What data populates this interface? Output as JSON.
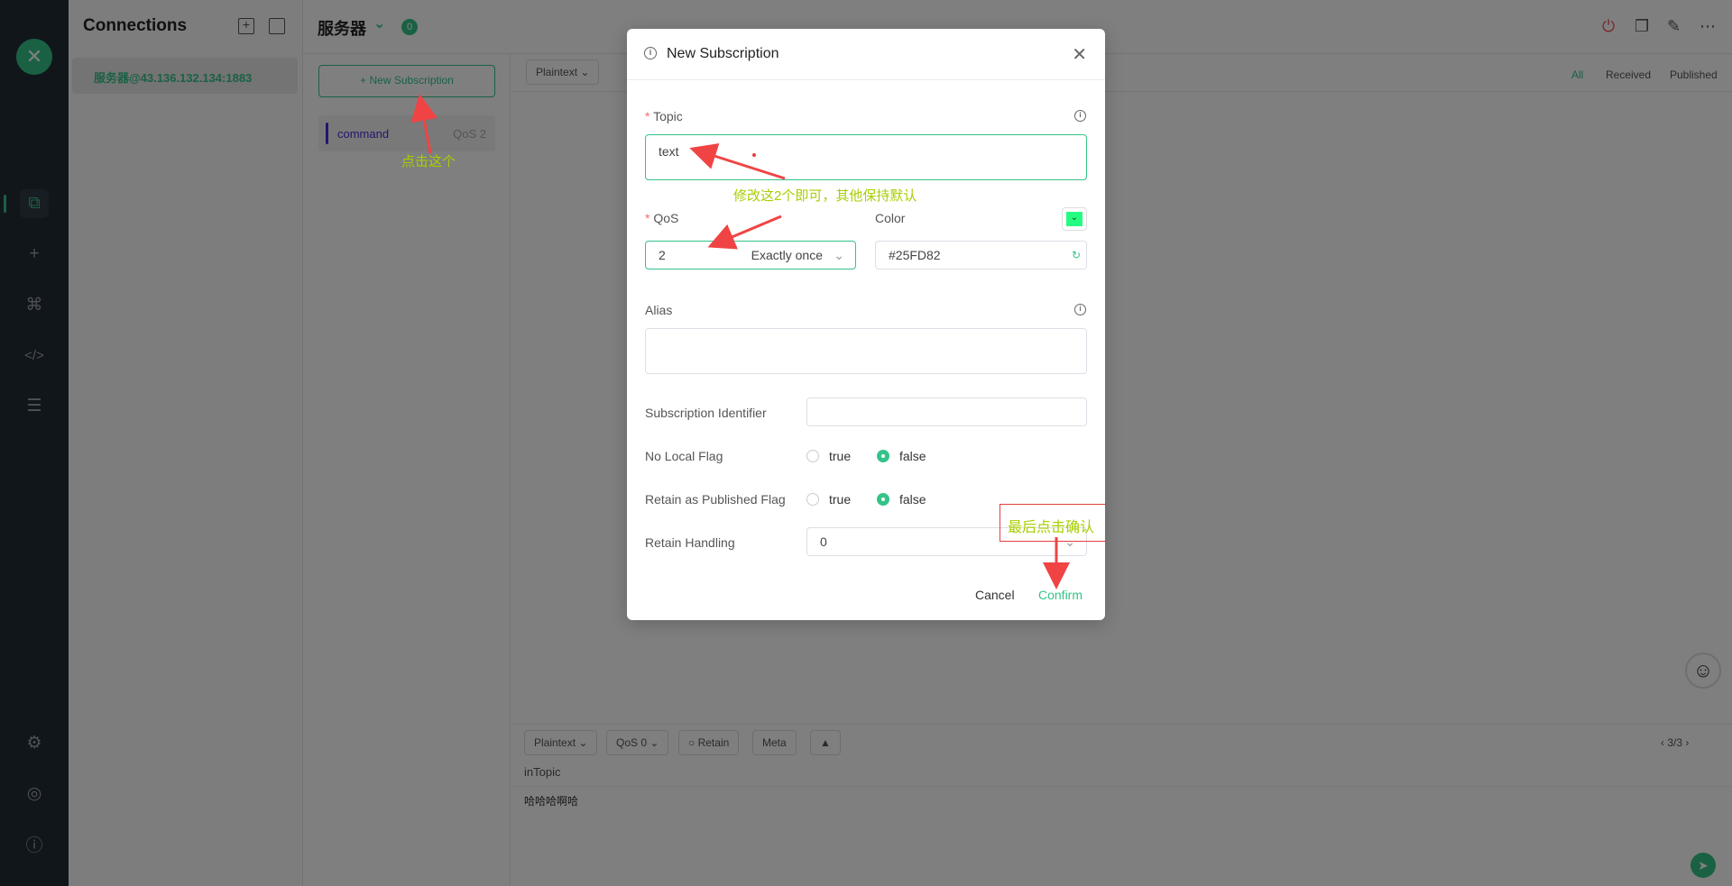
{
  "nav": {
    "logo": "✕",
    "icons": [
      "connections-icon",
      "plus-icon",
      "topology-icon",
      "code-icon",
      "log-icon",
      "settings-icon",
      "feed-icon",
      "about-icon"
    ]
  },
  "connections": {
    "title": "Connections",
    "items": [
      {
        "label": "服务器@43.136.132.134:1883"
      }
    ]
  },
  "topbar": {
    "name": "服务器",
    "badge": "0"
  },
  "subscriptions": {
    "new_label": "+ New Subscription",
    "items": [
      {
        "topic": "command",
        "qos": "QoS 2",
        "color": "#4b2bd8"
      }
    ]
  },
  "messages": {
    "format": "Plaintext",
    "filters": [
      "All",
      "Received",
      "Published"
    ]
  },
  "composer": {
    "format": "Plaintext",
    "qos": "QoS 0",
    "retain": "Retain",
    "meta": "Meta",
    "pagination": "3/3",
    "topic": "inTopic",
    "payload": "哈哈哈啊哈"
  },
  "dialog": {
    "title": "New Subscription",
    "topic_label": "Topic",
    "topic_value": "text",
    "qos_label": "QoS",
    "qos_value": "2",
    "qos_text": "Exactly once",
    "color_label": "Color",
    "color_value": "#25FD82",
    "alias_label": "Alias",
    "alias_value": "",
    "sub_id_label": "Subscription Identifier",
    "sub_id_value": "",
    "no_local_label": "No Local Flag",
    "retain_pub_label": "Retain as Published Flag",
    "retain_handling_label": "Retain Handling",
    "retain_handling_value": "0",
    "true_label": "true",
    "false_label": "false",
    "cancel": "Cancel",
    "confirm": "Confirm"
  },
  "annotations": {
    "click_this": "点击这个",
    "modify_two": "修改这2个即可，其他保持默认",
    "finally_confirm": "最后点击确认"
  },
  "colors": {
    "accent": "#34c388",
    "topic_color": "#4b2bd8",
    "annotation_text": "#a6cf00",
    "annotation_arrow": "#f04444"
  }
}
